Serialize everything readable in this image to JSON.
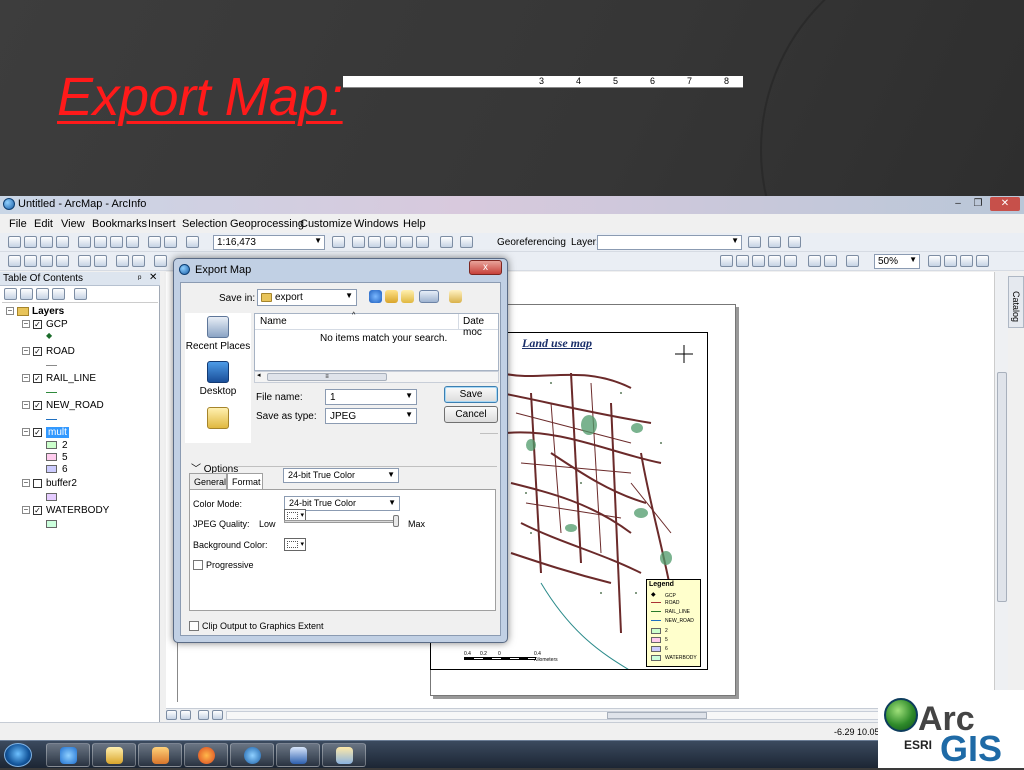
{
  "slide": {
    "title": "Export Map:"
  },
  "window": {
    "title": "Untitled - ArcMap - ArcInfo"
  },
  "menu": [
    "File",
    "Edit",
    "View",
    "Bookmarks",
    "Insert",
    "Selection",
    "Geoprocessing",
    "Customize",
    "Windows",
    "Help"
  ],
  "toolbar": {
    "scale": "1:16,473",
    "georeferencing_label": "Georeferencing",
    "layer_label": "Layer:",
    "zoom": "50%"
  },
  "toc": {
    "title": "Table Of Contents",
    "root": "Layers",
    "layers": [
      {
        "name": "GCP",
        "checked": true
      },
      {
        "name": "ROAD",
        "checked": true
      },
      {
        "name": "RAIL_LINE",
        "checked": true
      },
      {
        "name": "NEW_ROAD",
        "checked": true
      },
      {
        "name": "mult",
        "checked": true,
        "selected": true,
        "classes": [
          "2",
          "5",
          "6"
        ]
      },
      {
        "name": "buffer2",
        "checked": false
      },
      {
        "name": "WATERBODY",
        "checked": true
      }
    ],
    "colors": {
      "class2": "#ccffcc",
      "class5": "#ffccee",
      "class6": "#ccccff",
      "buffer2": "#e5ccff",
      "waterbody": "#ccffdd"
    }
  },
  "ruler": [
    "3",
    "4",
    "5",
    "6",
    "7",
    "8"
  ],
  "map": {
    "title": "Land use map",
    "legend_title": "Legend",
    "legend_items": [
      "GCP",
      "ROAD",
      "RAIL_LINE",
      "NEW_ROAD",
      "2",
      "5",
      "6",
      "WATERBODY"
    ],
    "scale_labels": [
      "0.4",
      "0.2",
      "0",
      "0.4 Kilometers"
    ]
  },
  "status": {
    "coords": "-6.29  10.05"
  },
  "dialog": {
    "title": "Export Map",
    "close": "x",
    "save_in_label": "Save in:",
    "save_in_value": "export",
    "places": [
      "Recent Places",
      "Desktop"
    ],
    "col_name": "Name",
    "col_date": "Date moc",
    "empty_text": "No items match your search.",
    "file_name_label": "File name:",
    "file_name_value": "1",
    "save_type_label": "Save as type:",
    "save_type_value": "JPEG",
    "save_button": "Save",
    "cancel_button": "Cancel",
    "options_label": "Options",
    "tab_general": "General",
    "tab_format": "Format",
    "format_value": "24-bit True Color",
    "color_mode_label": "Color Mode:",
    "color_mode_value": "24-bit True Color",
    "jpeg_quality_label": "JPEG Quality:",
    "low": "Low",
    "max": "Max",
    "jpeg_quality": 1.0,
    "background_color_label": "Background Color:",
    "progressive_label": "Progressive",
    "clip_label": "Clip Output to Graphics Extent"
  },
  "logo": {
    "arc": "Arc",
    "esri": "ESRI",
    "gis": "GIS"
  }
}
